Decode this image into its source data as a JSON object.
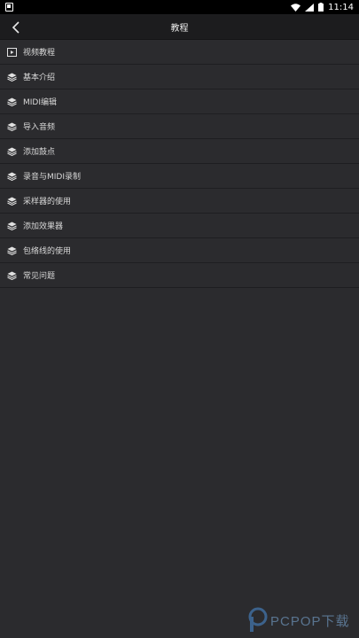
{
  "status_bar": {
    "time": "11:14",
    "icons": [
      "notification-icon",
      "wifi-icon",
      "signal-icon",
      "battery-icon"
    ]
  },
  "app_bar": {
    "title": "教程",
    "back_icon": "back-arrow-icon"
  },
  "menu": {
    "items": [
      {
        "label": "视频教程",
        "icon": "video-icon"
      },
      {
        "label": "基本介绍",
        "icon": "layers-icon"
      },
      {
        "label": "MIDI编辑",
        "icon": "layers-icon"
      },
      {
        "label": "导入音频",
        "icon": "layers-icon"
      },
      {
        "label": "添加鼓点",
        "icon": "layers-icon"
      },
      {
        "label": "录音与MIDI录制",
        "icon": "layers-icon"
      },
      {
        "label": "采样器的使用",
        "icon": "layers-icon"
      },
      {
        "label": "添加效果器",
        "icon": "layers-icon"
      },
      {
        "label": "包络线的使用",
        "icon": "layers-icon"
      },
      {
        "label": "常见问题",
        "icon": "layers-icon"
      }
    ]
  },
  "watermark": {
    "text": "PCPOP下载"
  }
}
